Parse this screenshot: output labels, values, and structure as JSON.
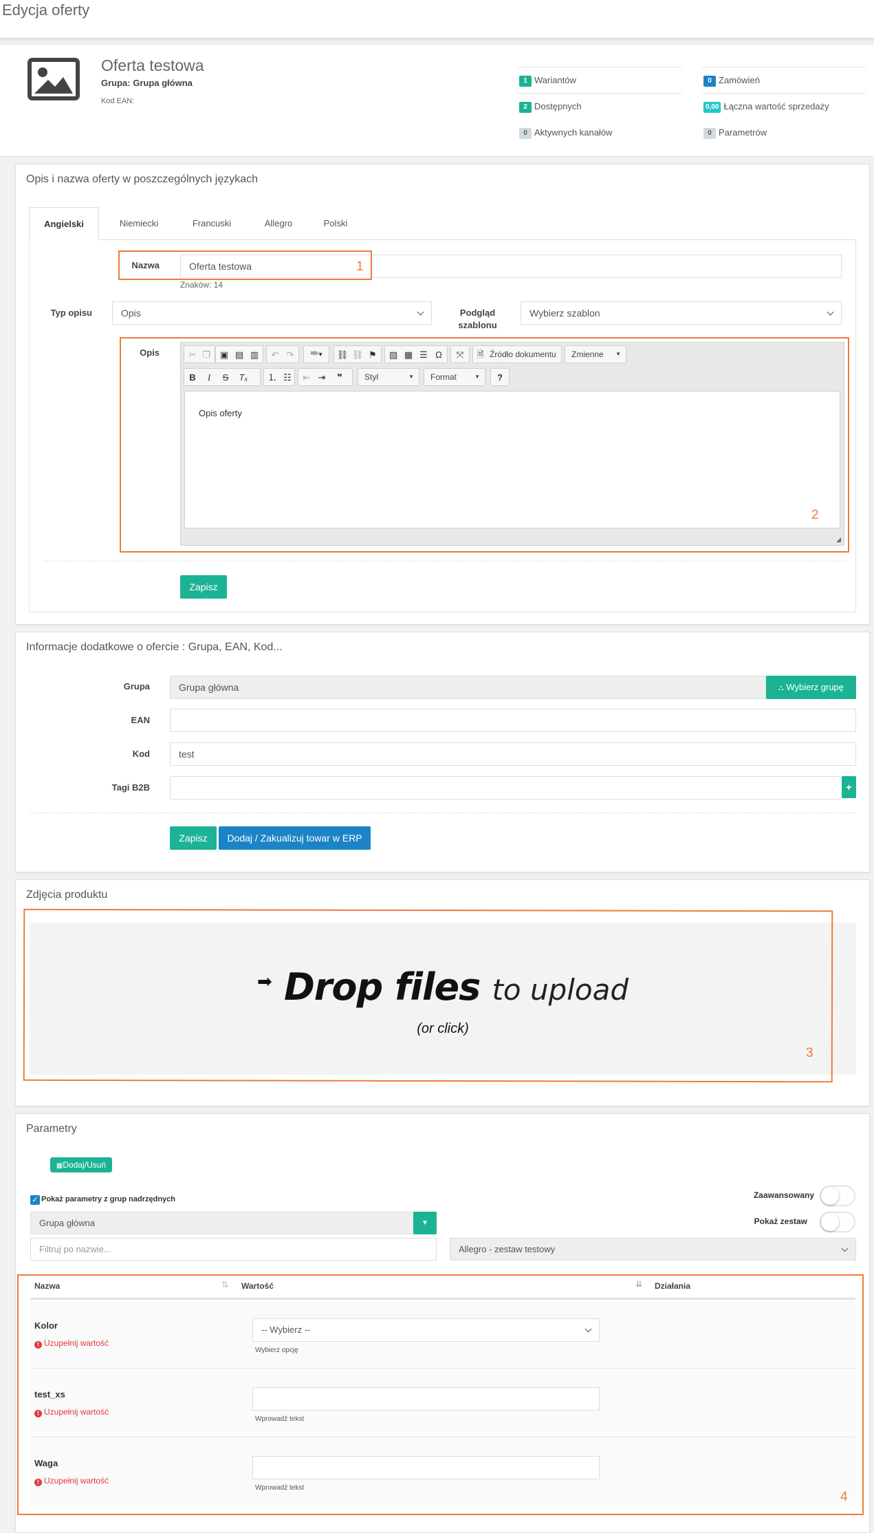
{
  "page_title": "Edycja oferty",
  "offer": {
    "name": "Oferta testowa",
    "group_line": "Grupa: Grupa główna",
    "ean_line": "Kod EAN:"
  },
  "stats": {
    "variants": {
      "value": "1",
      "label": "Wariantów",
      "color": "#1cb394"
    },
    "available": {
      "value": "2",
      "label": "Dostępnych",
      "color": "#1cb394"
    },
    "channels": {
      "value": "0",
      "label": "Aktywnych kanałów",
      "color": "#d1dade"
    },
    "orders": {
      "value": "0",
      "label": "Zamówień",
      "color": "#1c84c6"
    },
    "sales": {
      "value": "0,00",
      "label": "Łączna wartość sprzedaży",
      "color": "#23c6c8"
    },
    "params": {
      "value": "0",
      "label": "Parametrów",
      "color": "#d1dade"
    }
  },
  "desc_panel": {
    "title": "Opis i nazwa oferty w poszczególnych językach",
    "tabs": [
      "Angielski",
      "Niemiecki",
      "Francuski",
      "Allegro",
      "Polski"
    ],
    "name_label": "Nazwa",
    "name_value": "Oferta testowa",
    "char_count": "Znaków: 14",
    "type_label": "Typ opisu",
    "type_value": "Opis",
    "preview_label_1": "Podgląd",
    "preview_label_2": "szablonu",
    "preview_value": "Wybierz szablon",
    "desc_label": "Opis",
    "editor": {
      "source_btn": "Źródło dokumentu",
      "vars_btn": "Zmienne",
      "style_btn": "Styl",
      "format_btn": "Format",
      "content": "Opis oferty"
    },
    "save_btn": "Zapisz"
  },
  "info_panel": {
    "title": "Informacje dodatkowe o ofercie : Grupa, EAN, Kod...",
    "group_label": "Grupa",
    "group_value": "Grupa główna",
    "choose_group_btn": "Wybierz grupę",
    "ean_label": "EAN",
    "ean_value": "",
    "code_label": "Kod",
    "code_value": "test",
    "tags_label": "Tagi B2B",
    "save_btn": "Zapisz",
    "erp_btn": "Dodaj / Zakualizuj towar w ERP"
  },
  "photos_panel": {
    "title": "Zdjęcia produktu",
    "drop_bold": "Drop files",
    "drop_light": "to upload",
    "drop_sub": "(or click)"
  },
  "params_panel": {
    "title": "Parametry",
    "add_remove_btn": "Dodaj/Usuń",
    "show_parent_label": "Pokaż parametry z grup nadrzędnych",
    "group_select": "Grupa główna",
    "filter_placeholder": "Filtruj po nazwie...",
    "advanced_label": "Zaawansowany",
    "show_set_label": "Pokaż zestaw",
    "set_select": "Allegro - zestaw testowy",
    "col_name": "Nazwa",
    "col_value": "Wartość",
    "col_actions": "Działania",
    "rows": [
      {
        "name": "Kolor",
        "error": "Uzupełnij wartość",
        "input": "-- Wybierz --",
        "hint": "Wybierz opcję"
      },
      {
        "name": "test_xs",
        "error": "Uzupełnij wartość",
        "input": "",
        "hint": "Wprowadź tekst"
      },
      {
        "name": "Waga",
        "error": "Uzupełnij wartość",
        "input": "",
        "hint": "Wprowadź tekst"
      }
    ]
  },
  "annotations": [
    "1",
    "2",
    "3",
    "4"
  ]
}
